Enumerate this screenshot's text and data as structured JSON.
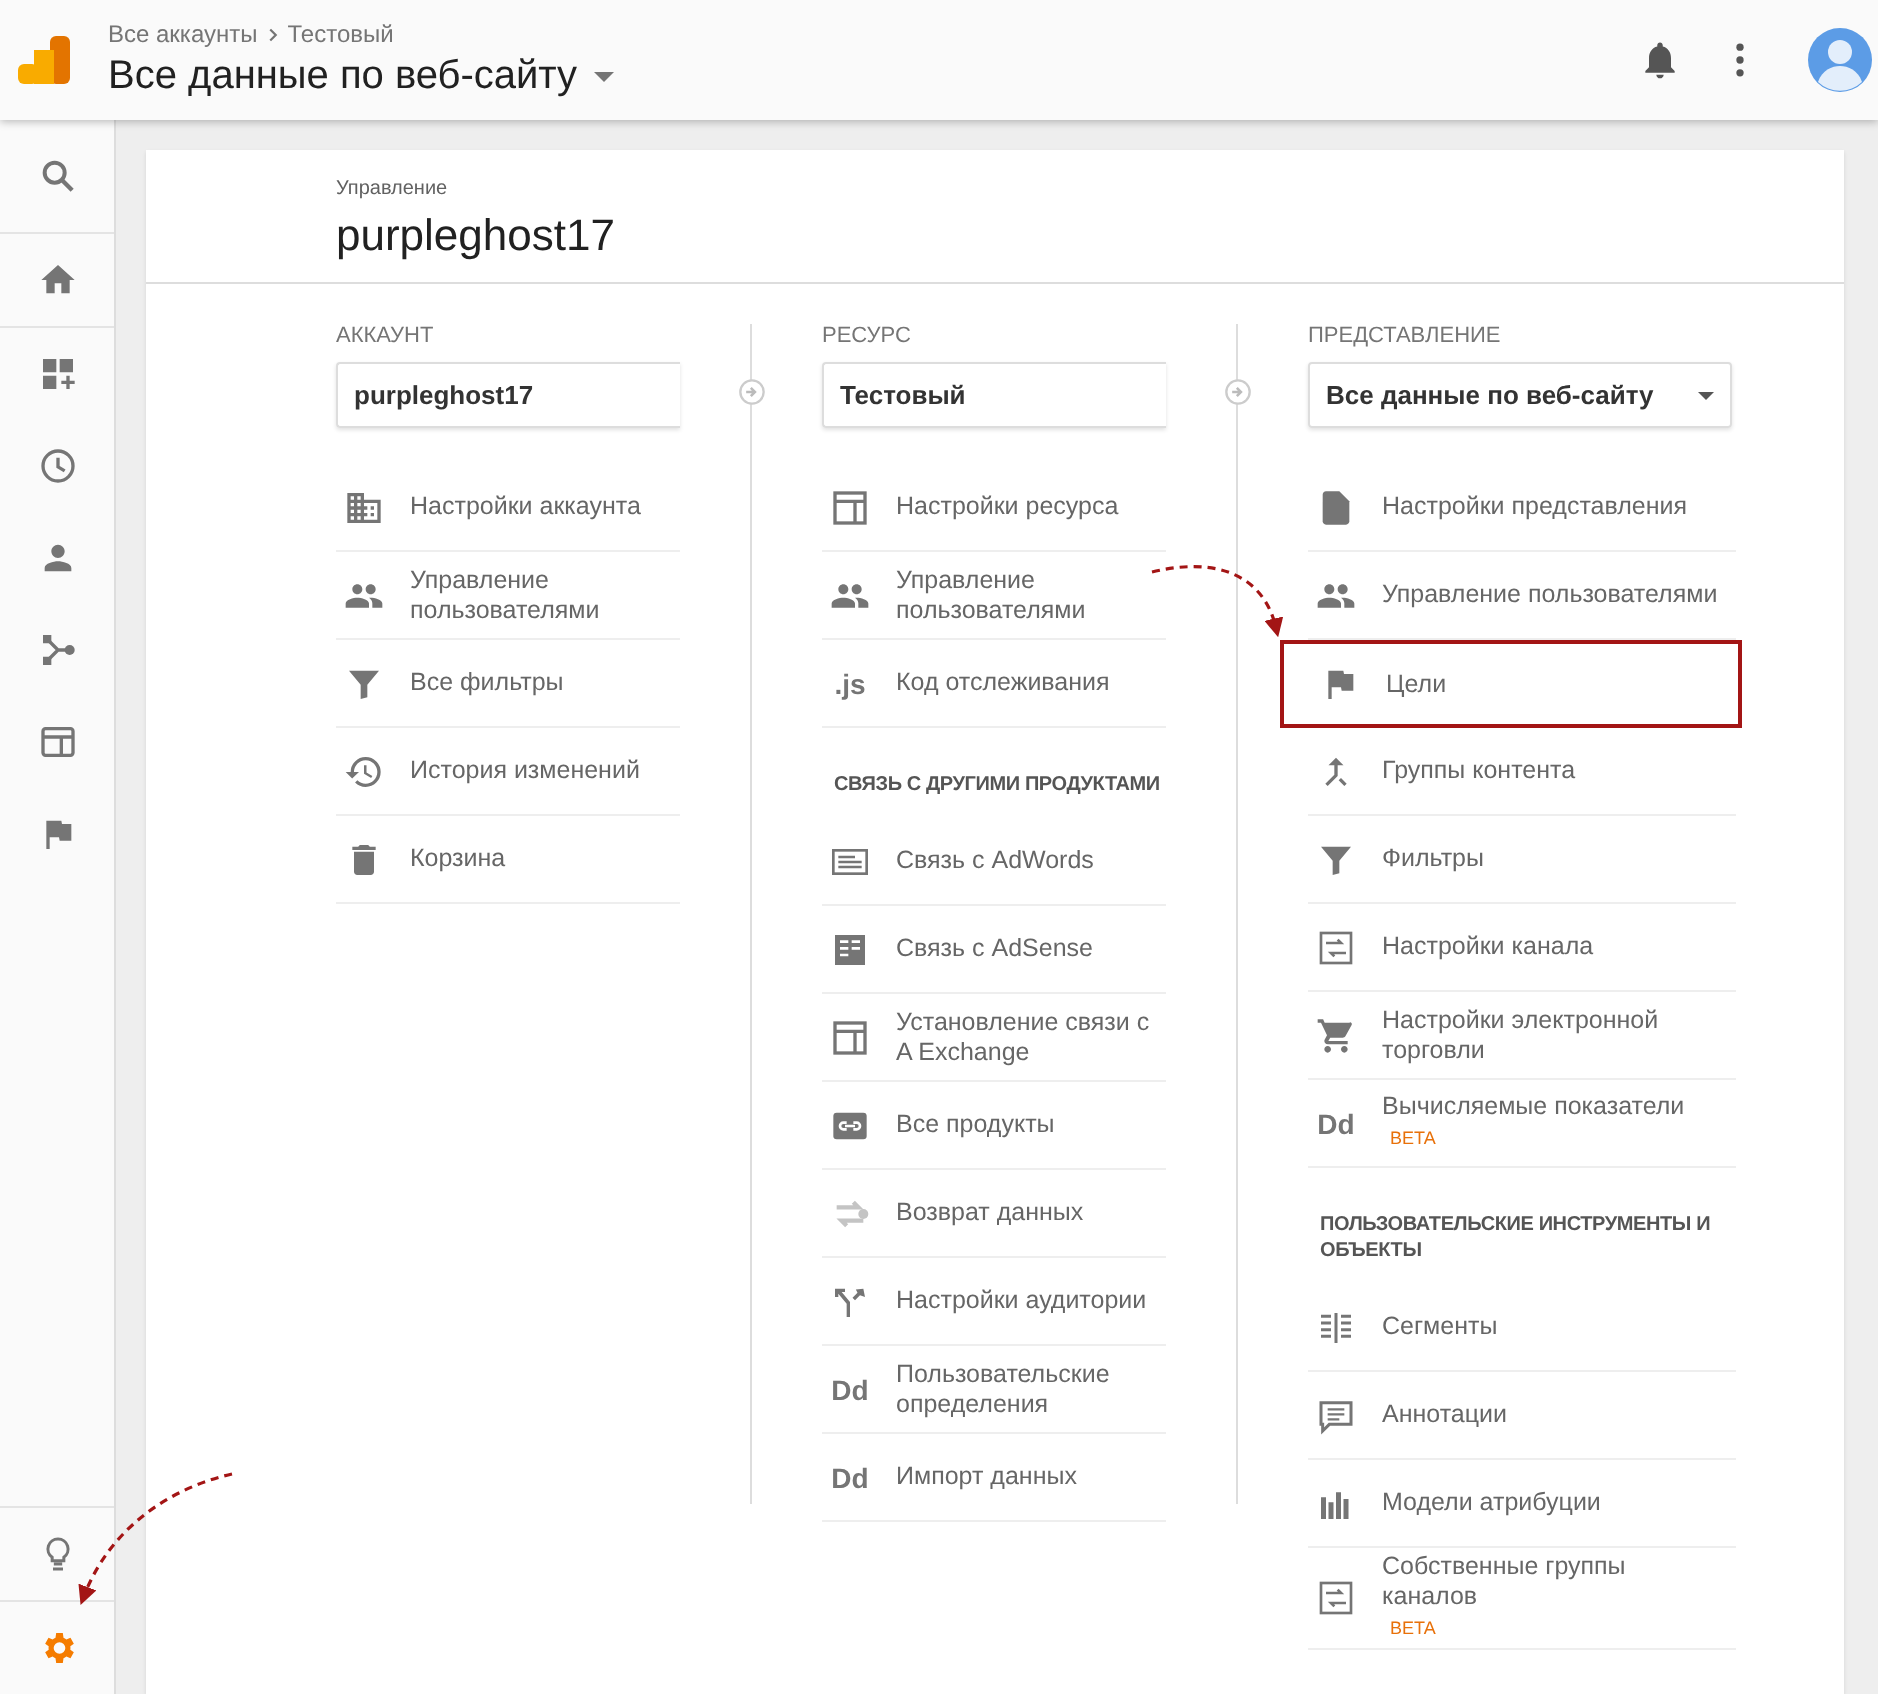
{
  "header": {
    "breadcrumbs": [
      "Все аккаунты",
      "Тестовый"
    ],
    "title": "Все данные по веб-сайту"
  },
  "nav": [
    {
      "selected": false
    },
    {
      "selected": false
    },
    {
      "selected": false
    },
    {
      "selected": false
    },
    {
      "selected": false
    },
    {
      "selected": false
    },
    {
      "selected": false
    },
    {
      "selected": false
    },
    {
      "selected": false
    },
    {
      "selected": true
    }
  ],
  "admin": {
    "label": "Управление",
    "title": "purpleghost17"
  },
  "columns": [
    {
      "heading": "АККАУНТ",
      "selector": {
        "value": "purpleghost17",
        "caret": false
      },
      "items": [
        {
          "kind": "item",
          "label": "Настройки аккаунта",
          "highlighted": false
        },
        {
          "kind": "item",
          "label": "Управление пользователями",
          "highlighted": false
        },
        {
          "kind": "item",
          "label": "Все фильтры",
          "highlighted": false
        },
        {
          "kind": "item",
          "label": "История изменений",
          "highlighted": false
        },
        {
          "kind": "item",
          "label": "Корзина",
          "highlighted": false
        }
      ]
    },
    {
      "heading": "РЕСУРС",
      "selector": {
        "value": "Тестовый",
        "caret": false
      },
      "items": [
        {
          "kind": "item",
          "label": "Настройки ресурса",
          "highlighted": false
        },
        {
          "kind": "item",
          "label": "Управление пользователями",
          "highlighted": false
        },
        {
          "kind": "item",
          "label": "Код отслеживания",
          "glyph": ".js",
          "highlighted": false
        },
        {
          "kind": "section",
          "label": "СВЯЗЬ С ДРУГИМИ ПРОДУКТАМИ"
        },
        {
          "kind": "item",
          "label": "Связь с AdWords",
          "highlighted": false
        },
        {
          "kind": "item",
          "label": "Связь с AdSense",
          "highlighted": false
        },
        {
          "kind": "item",
          "label": "Установление связи с A Exchange",
          "highlighted": false
        },
        {
          "kind": "item",
          "label": "Все продукты",
          "highlighted": false
        },
        {
          "kind": "item",
          "label": "Возврат данных",
          "highlighted": false
        },
        {
          "kind": "item",
          "label": "Настройки аудитории",
          "highlighted": false
        },
        {
          "kind": "item",
          "label": "Пользовательские определения",
          "glyph": "Dd",
          "highlighted": false
        },
        {
          "kind": "item",
          "label": "Импорт данных",
          "glyph": "Dd",
          "highlighted": false
        }
      ]
    },
    {
      "heading": "ПРЕДСТАВЛЕНИЕ",
      "selector": {
        "value": "Все данные по веб-сайту",
        "caret": true
      },
      "items": [
        {
          "kind": "item",
          "label": "Настройки представления",
          "highlighted": false
        },
        {
          "kind": "item",
          "label": "Управление пользователями",
          "highlighted": false
        },
        {
          "kind": "item",
          "label": "Цели",
          "highlighted": true
        },
        {
          "kind": "item",
          "label": "Группы контента",
          "highlighted": false
        },
        {
          "kind": "item",
          "label": "Фильтры",
          "highlighted": false
        },
        {
          "kind": "item",
          "label": "Настройки канала",
          "highlighted": false
        },
        {
          "kind": "item",
          "label": "Настройки электронной торговли",
          "highlighted": false
        },
        {
          "kind": "item",
          "label": "Вычисляемые показатели",
          "glyph": "Dd",
          "badge": "BETA",
          "highlighted": false
        },
        {
          "kind": "section",
          "label": "ПОЛЬЗОВАТЕЛЬСКИЕ ИНСТРУМЕНТЫ И ОБЪЕКТЫ"
        },
        {
          "kind": "item",
          "label": "Сегменты",
          "highlighted": false
        },
        {
          "kind": "item",
          "label": "Аннотации",
          "highlighted": false
        },
        {
          "kind": "item",
          "label": "Модели атрибуции",
          "highlighted": false
        },
        {
          "kind": "item",
          "label": "Собственные группы каналов",
          "badge": "BETA",
          "highlighted": false
        }
      ]
    }
  ]
}
